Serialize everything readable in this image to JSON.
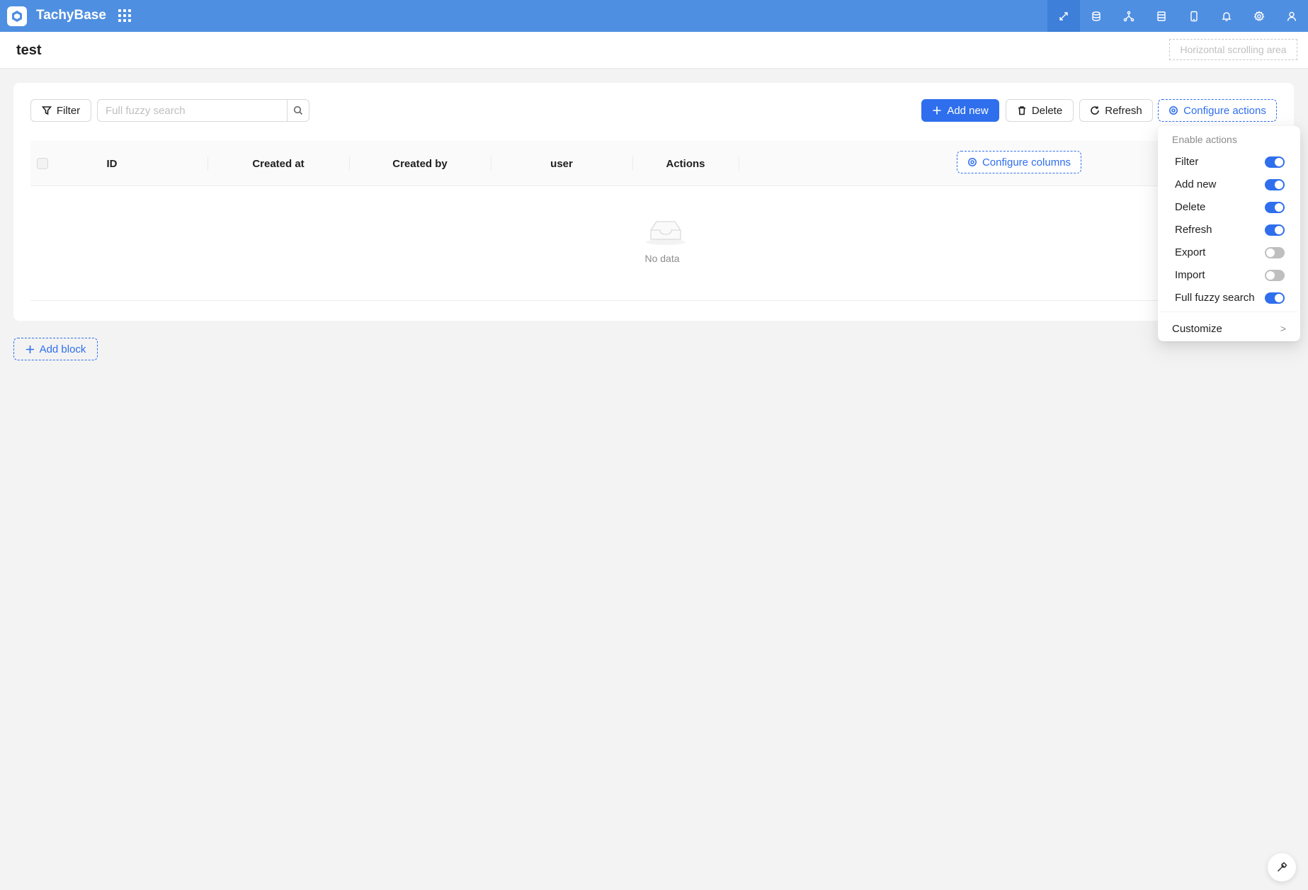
{
  "app": {
    "brand": "TachyBase",
    "colors": {
      "topbar": "#4f8fe1",
      "primary": "#2f6fed"
    },
    "top_icons": [
      "ui-editor-icon",
      "database-icon",
      "workflow-icon",
      "table-icon",
      "mobile-icon",
      "bell-icon",
      "gear-icon",
      "user-icon"
    ]
  },
  "page": {
    "title": "test",
    "horizontal_scroll_label": "Horizontal scrolling area"
  },
  "toolbar": {
    "filter_label": "Filter",
    "search_placeholder": "Full fuzzy search",
    "add_new_label": "Add new",
    "delete_label": "Delete",
    "refresh_label": "Refresh",
    "configure_actions_label": "Configure actions"
  },
  "table": {
    "columns": [
      "ID",
      "Created at",
      "Created by",
      "user",
      "Actions"
    ],
    "configure_columns_label": "Configure columns",
    "empty_text": "No data"
  },
  "add_block_label": "Add block",
  "dropdown": {
    "group_title": "Enable actions",
    "items": [
      {
        "label": "Filter",
        "enabled": true
      },
      {
        "label": "Add new",
        "enabled": true
      },
      {
        "label": "Delete",
        "enabled": true
      },
      {
        "label": "Refresh",
        "enabled": true
      },
      {
        "label": "Export",
        "enabled": false
      },
      {
        "label": "Import",
        "enabled": false
      },
      {
        "label": "Full fuzzy search",
        "enabled": true
      }
    ],
    "customize_label": "Customize",
    "customize_chevron": ">"
  }
}
